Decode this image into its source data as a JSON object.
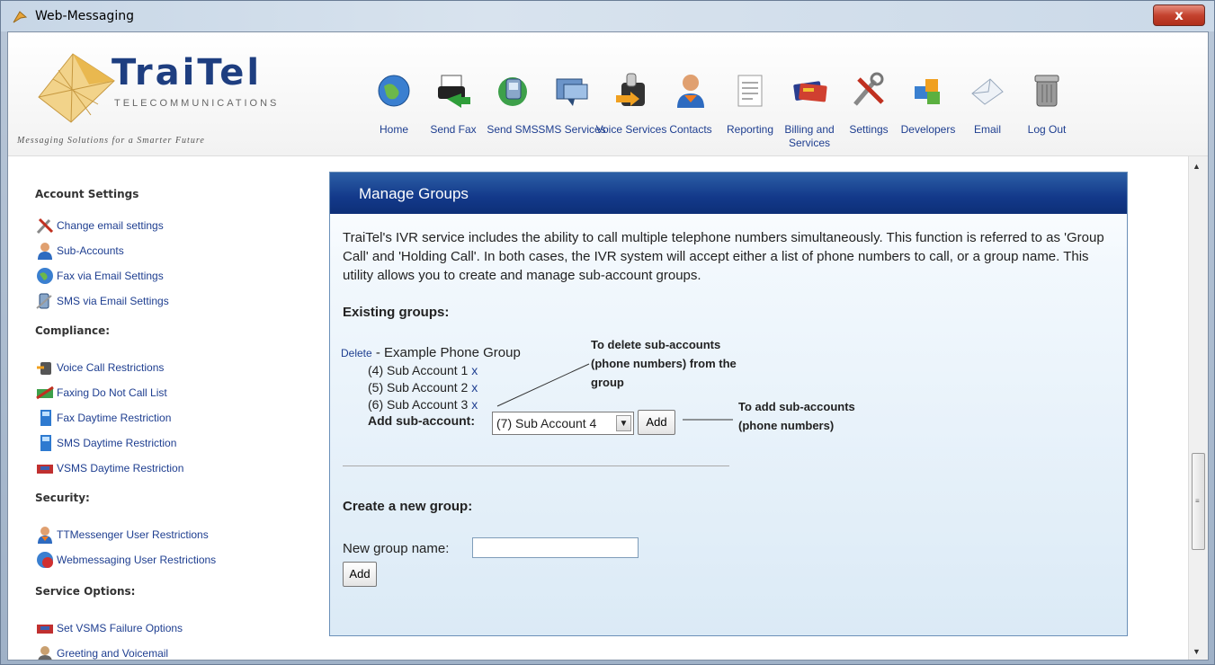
{
  "window": {
    "title": "Web-Messaging",
    "close_label": "x"
  },
  "brand": {
    "name": "TraiTel",
    "subtitle": "TELECOMMUNICATIONS",
    "tagline": "Messaging Solutions for a Smarter Future"
  },
  "nav": [
    {
      "label": "Home",
      "icon": "globe-icon"
    },
    {
      "label": "Send Fax",
      "icon": "fax-icon"
    },
    {
      "label": "Send SMS",
      "icon": "sms-icon"
    },
    {
      "label": "SMS Services",
      "icon": "sms-services-icon"
    },
    {
      "label": "Voice Services",
      "icon": "voice-icon"
    },
    {
      "label": "Contacts",
      "icon": "contacts-icon"
    },
    {
      "label": "Reporting",
      "icon": "reporting-icon"
    },
    {
      "label": "Billing and Services",
      "icon": "billing-icon"
    },
    {
      "label": "Settings",
      "icon": "settings-icon"
    },
    {
      "label": "Developers",
      "icon": "developers-icon"
    },
    {
      "label": "Email",
      "icon": "email-icon"
    },
    {
      "label": "Log Out",
      "icon": "logout-icon"
    }
  ],
  "sidebar": {
    "account_heading": "Account Settings",
    "account_items": [
      "Change email settings",
      "Sub-Accounts",
      "Fax via Email Settings",
      "SMS via Email Settings"
    ],
    "compliance_heading": "Compliance:",
    "compliance_items": [
      "Voice Call Restrictions",
      "Faxing Do Not Call List",
      "Fax Daytime Restriction",
      "SMS Daytime Restriction",
      "VSMS Daytime Restriction"
    ],
    "security_heading": "Security:",
    "security_items": [
      "TTMessenger User Restrictions",
      "Webmessaging User Restrictions"
    ],
    "service_heading": "Service Options:",
    "service_items": [
      "Set VSMS Failure Options",
      "Greeting and Voicemail"
    ]
  },
  "panel": {
    "title": "Manage Groups",
    "description": "TraiTel's IVR service includes the ability to call multiple telephone numbers simultaneously. This function is referred to as 'Group Call' and 'Holding Call'. In both cases, the IVR system will accept either a list of phone numbers to call, or a group name. This utility allows you to create and manage sub-account groups.",
    "existing_title": "Existing groups:",
    "delete_link": "Delete",
    "group_name": "- Example Phone Group",
    "sub_accounts": [
      "(4) Sub Account 1",
      "(5) Sub Account 2",
      "(6) Sub Account 3"
    ],
    "remove_label": "x",
    "add_sub_label": "Add sub-account:",
    "add_sub_selected": "(7) Sub Account 4",
    "add_button": "Add",
    "create_title": "Create a new group:",
    "new_group_label": "New group name:",
    "new_group_value": "",
    "create_add_button": "Add"
  },
  "annotations": {
    "delete_note": [
      "To delete sub-accounts",
      "(phone numbers) from the",
      "group"
    ],
    "add_note": [
      "To add sub-accounts",
      "(phone numbers)"
    ]
  }
}
